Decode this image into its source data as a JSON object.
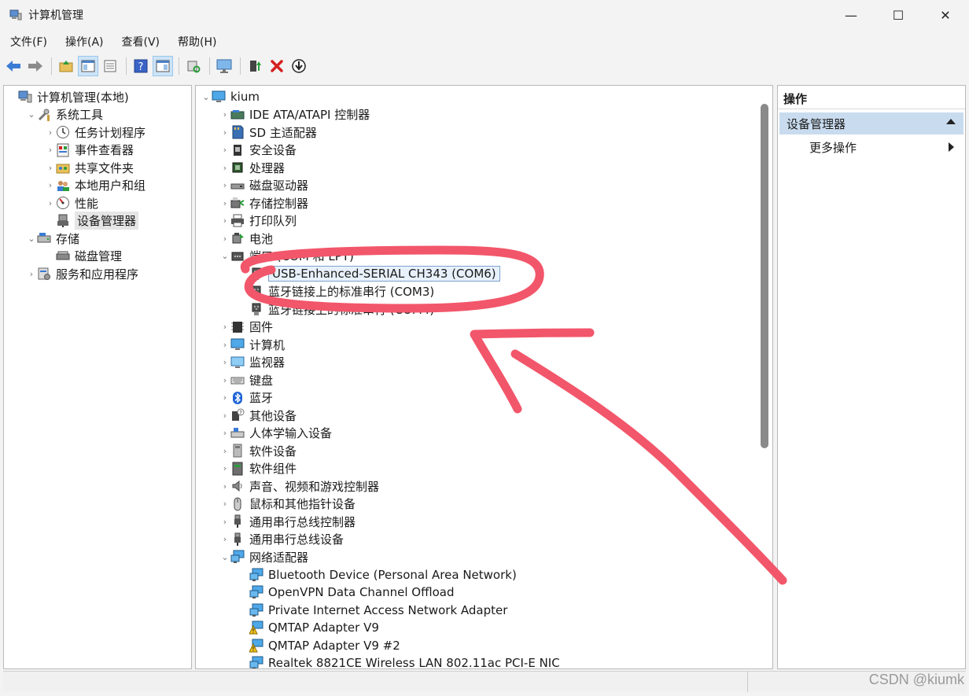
{
  "window": {
    "title": "计算机管理",
    "controls": {
      "minimize": "—",
      "maximize": "☐",
      "close": "✕"
    }
  },
  "menu": [
    "文件(F)",
    "操作(A)",
    "查看(V)",
    "帮助(H)"
  ],
  "toolbar": {
    "buttons": [
      "back-arrow-icon",
      "forward-arrow-icon",
      "up-folder-icon",
      "show-hide-tree-icon",
      "properties-icon",
      "help-icon",
      "show-hide-action-icon",
      "scan-hardware-icon",
      "monitor-icon",
      "update-driver-icon",
      "uninstall-icon",
      "disable-device-icon"
    ],
    "accent_green": "#2a9d3a",
    "accent_red": "#d42020",
    "accent_blue": "#3a7bd5"
  },
  "left_tree": [
    {
      "label": "计算机管理(本地)",
      "level": 0,
      "chevron": "",
      "icon": "computer-management-icon"
    },
    {
      "label": "系统工具",
      "level": 1,
      "chevron": "⌄",
      "icon": "tools-icon"
    },
    {
      "label": "任务计划程序",
      "level": 2,
      "chevron": "›",
      "icon": "clock-icon"
    },
    {
      "label": "事件查看器",
      "level": 2,
      "chevron": "›",
      "icon": "event-viewer-icon"
    },
    {
      "label": "共享文件夹",
      "level": 2,
      "chevron": "›",
      "icon": "shared-folder-icon"
    },
    {
      "label": "本地用户和组",
      "level": 2,
      "chevron": "›",
      "icon": "users-icon"
    },
    {
      "label": "性能",
      "level": 2,
      "chevron": "›",
      "icon": "performance-icon"
    },
    {
      "label": "设备管理器",
      "level": 2,
      "chevron": "",
      "icon": "device-manager-icon",
      "selected": true
    },
    {
      "label": "存储",
      "level": 1,
      "chevron": "⌄",
      "icon": "storage-icon"
    },
    {
      "label": "磁盘管理",
      "level": 2,
      "chevron": "",
      "icon": "disk-icon"
    },
    {
      "label": "服务和应用程序",
      "level": 1,
      "chevron": "›",
      "icon": "services-icon"
    }
  ],
  "device_tree": {
    "root": "kium",
    "items": [
      {
        "label": "IDE ATA/ATAPI 控制器",
        "level": 1,
        "chevron": "›",
        "icon": "ide-controller-icon"
      },
      {
        "label": "SD 主适配器",
        "level": 1,
        "chevron": "›",
        "icon": "sd-adapter-icon"
      },
      {
        "label": "安全设备",
        "level": 1,
        "chevron": "›",
        "icon": "security-device-icon"
      },
      {
        "label": "处理器",
        "level": 1,
        "chevron": "›",
        "icon": "processor-icon"
      },
      {
        "label": "磁盘驱动器",
        "level": 1,
        "chevron": "›",
        "icon": "disk-drive-icon"
      },
      {
        "label": "存储控制器",
        "level": 1,
        "chevron": "›",
        "icon": "storage-controller-icon"
      },
      {
        "label": "打印队列",
        "level": 1,
        "chevron": "›",
        "icon": "printer-icon"
      },
      {
        "label": "电池",
        "level": 1,
        "chevron": "›",
        "icon": "battery-icon"
      },
      {
        "label": "端口 (COM 和 LPT)",
        "level": 1,
        "chevron": "⌄",
        "icon": "port-icon"
      },
      {
        "label": "USB-Enhanced-SERIAL CH343 (COM6)",
        "level": 2,
        "chevron": "",
        "icon": "serial-port-icon",
        "selected": true
      },
      {
        "label": "蓝牙链接上的标准串行 (COM3)",
        "level": 2,
        "chevron": "",
        "icon": "serial-port-icon"
      },
      {
        "label": "蓝牙链接上的标准串行 (COM4)",
        "level": 2,
        "chevron": "",
        "icon": "serial-port-icon"
      },
      {
        "label": "固件",
        "level": 1,
        "chevron": "›",
        "icon": "firmware-icon"
      },
      {
        "label": "计算机",
        "level": 1,
        "chevron": "›",
        "icon": "computer-icon"
      },
      {
        "label": "监视器",
        "level": 1,
        "chevron": "›",
        "icon": "monitor-icon"
      },
      {
        "label": "键盘",
        "level": 1,
        "chevron": "›",
        "icon": "keyboard-icon"
      },
      {
        "label": "蓝牙",
        "level": 1,
        "chevron": "›",
        "icon": "bluetooth-icon"
      },
      {
        "label": "其他设备",
        "level": 1,
        "chevron": "›",
        "icon": "other-device-icon"
      },
      {
        "label": "人体学输入设备",
        "level": 1,
        "chevron": "›",
        "icon": "hid-icon"
      },
      {
        "label": "软件设备",
        "level": 1,
        "chevron": "›",
        "icon": "software-device-icon"
      },
      {
        "label": "软件组件",
        "level": 1,
        "chevron": "›",
        "icon": "software-component-icon"
      },
      {
        "label": "声音、视频和游戏控制器",
        "level": 1,
        "chevron": "›",
        "icon": "sound-icon"
      },
      {
        "label": "鼠标和其他指针设备",
        "level": 1,
        "chevron": "›",
        "icon": "mouse-icon"
      },
      {
        "label": "通用串行总线控制器",
        "level": 1,
        "chevron": "›",
        "icon": "usb-icon"
      },
      {
        "label": "通用串行总线设备",
        "level": 1,
        "chevron": "›",
        "icon": "usb-icon"
      },
      {
        "label": "网络适配器",
        "level": 1,
        "chevron": "⌄",
        "icon": "network-adapter-icon"
      },
      {
        "label": "Bluetooth Device (Personal Area Network)",
        "level": 2,
        "chevron": "",
        "icon": "network-adapter-icon"
      },
      {
        "label": "OpenVPN Data Channel Offload",
        "level": 2,
        "chevron": "",
        "icon": "network-adapter-icon"
      },
      {
        "label": "Private Internet Access Network Adapter",
        "level": 2,
        "chevron": "",
        "icon": "network-adapter-icon"
      },
      {
        "label": "QMTAP Adapter V9",
        "level": 2,
        "chevron": "",
        "icon": "network-warning-icon"
      },
      {
        "label": "QMTAP Adapter V9 #2",
        "level": 2,
        "chevron": "",
        "icon": "network-warning-icon"
      },
      {
        "label": "Realtek 8821CE Wireless LAN 802.11ac PCI-E NIC",
        "level": 2,
        "chevron": "",
        "icon": "network-adapter-icon"
      }
    ]
  },
  "actions": {
    "header": "操作",
    "section": "设备管理器",
    "more": "更多操作"
  },
  "annotation": {
    "color": "#f2566a"
  },
  "watermark": "CSDN @kiumk"
}
